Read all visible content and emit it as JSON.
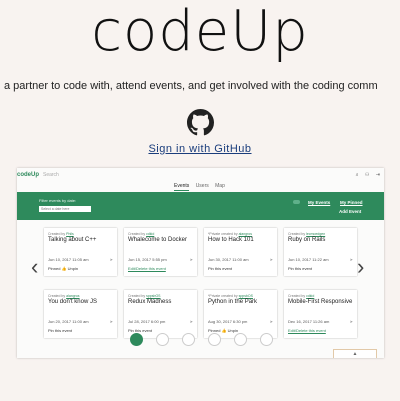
{
  "hero": {
    "brand": "codeUp",
    "tagline": "a partner to code with, attend events, and get involved with the coding comm",
    "signin_label": "Sign in with GitHub",
    "github_icon": "github-icon"
  },
  "app": {
    "logo": "codeUp",
    "search_placeholder": "Search",
    "tabs": [
      "Events",
      "Users",
      "Map"
    ],
    "active_tab": "Events",
    "filter_label": "Filter events by date:",
    "filter_placeholder": "Select a date here",
    "my_events": "My Events",
    "my_pinned": "My Pinned",
    "add_event": "Add Event",
    "accent_color": "#2e8a5c",
    "cards": [
      {
        "creator_prefix": "Created by",
        "creator": "Phils",
        "title": "Talking about C++",
        "date": "Jun 10, 2017 11:05 am",
        "action": "Pinned 👍 Unpin"
      },
      {
        "creator_prefix": "Created by",
        "creator": "cdkid",
        "title": "Whalecome to Docker",
        "date": "Jun 15, 2017 5:55 pm",
        "action": "Edit/Delete this event"
      },
      {
        "creator_prefix": "*Private created by",
        "creator": "alangros",
        "title": "How to Hack 101",
        "date": "Jun 30, 2017 11:00 am",
        "action": "Pin this event"
      },
      {
        "creator_prefix": "Created by",
        "creator": "lecmoedgen",
        "title": "Ruby on Rails",
        "date": "Jun 10, 2017 11:22 am",
        "action": "Pin this event"
      },
      {
        "creator_prefix": "Created by",
        "creator": "alangros",
        "title": "You don't know JS",
        "date": "Jun 20, 2017 11:00 am",
        "action": "Pin this event"
      },
      {
        "creator_prefix": "Created by",
        "creator": "sppsbOS",
        "title": "Redux Madness",
        "date": "Jul 28, 2017 6:00 pm",
        "action": "Pin this event"
      },
      {
        "creator_prefix": "*Private created by",
        "creator": "sppsbOS",
        "title": "Python in the Park",
        "date": "Aug 30, 2017 6:30 pm",
        "action": "Pinned 👍 Unpin"
      },
      {
        "creator_prefix": "Created by",
        "creator": "cdkid",
        "title": "Mobile-First Responsive",
        "date": "Dec 16, 2017 11:26 am",
        "action": "Edit/Delete this event"
      }
    ],
    "scroll_top_symbol": "▲"
  }
}
